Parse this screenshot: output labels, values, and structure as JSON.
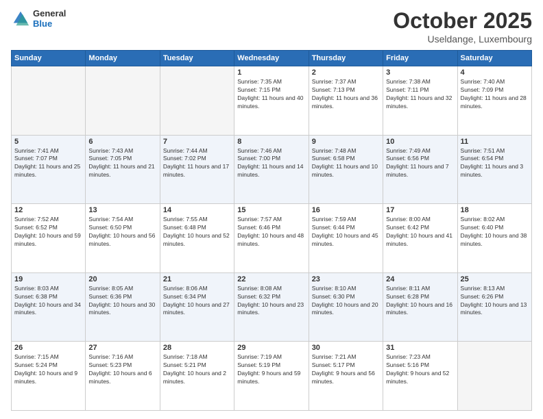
{
  "header": {
    "logo_general": "General",
    "logo_blue": "Blue",
    "title": "October 2025",
    "location": "Useldange, Luxembourg"
  },
  "weekdays": [
    "Sunday",
    "Monday",
    "Tuesday",
    "Wednesday",
    "Thursday",
    "Friday",
    "Saturday"
  ],
  "weeks": [
    [
      {
        "day": "",
        "empty": true
      },
      {
        "day": "",
        "empty": true
      },
      {
        "day": "",
        "empty": true
      },
      {
        "day": "1",
        "sunrise": "7:35 AM",
        "sunset": "7:15 PM",
        "daylight": "11 hours and 40 minutes."
      },
      {
        "day": "2",
        "sunrise": "7:37 AM",
        "sunset": "7:13 PM",
        "daylight": "11 hours and 36 minutes."
      },
      {
        "day": "3",
        "sunrise": "7:38 AM",
        "sunset": "7:11 PM",
        "daylight": "11 hours and 32 minutes."
      },
      {
        "day": "4",
        "sunrise": "7:40 AM",
        "sunset": "7:09 PM",
        "daylight": "11 hours and 28 minutes."
      }
    ],
    [
      {
        "day": "5",
        "sunrise": "7:41 AM",
        "sunset": "7:07 PM",
        "daylight": "11 hours and 25 minutes."
      },
      {
        "day": "6",
        "sunrise": "7:43 AM",
        "sunset": "7:05 PM",
        "daylight": "11 hours and 21 minutes."
      },
      {
        "day": "7",
        "sunrise": "7:44 AM",
        "sunset": "7:02 PM",
        "daylight": "11 hours and 17 minutes."
      },
      {
        "day": "8",
        "sunrise": "7:46 AM",
        "sunset": "7:00 PM",
        "daylight": "11 hours and 14 minutes."
      },
      {
        "day": "9",
        "sunrise": "7:48 AM",
        "sunset": "6:58 PM",
        "daylight": "11 hours and 10 minutes."
      },
      {
        "day": "10",
        "sunrise": "7:49 AM",
        "sunset": "6:56 PM",
        "daylight": "11 hours and 7 minutes."
      },
      {
        "day": "11",
        "sunrise": "7:51 AM",
        "sunset": "6:54 PM",
        "daylight": "11 hours and 3 minutes."
      }
    ],
    [
      {
        "day": "12",
        "sunrise": "7:52 AM",
        "sunset": "6:52 PM",
        "daylight": "10 hours and 59 minutes."
      },
      {
        "day": "13",
        "sunrise": "7:54 AM",
        "sunset": "6:50 PM",
        "daylight": "10 hours and 56 minutes."
      },
      {
        "day": "14",
        "sunrise": "7:55 AM",
        "sunset": "6:48 PM",
        "daylight": "10 hours and 52 minutes."
      },
      {
        "day": "15",
        "sunrise": "7:57 AM",
        "sunset": "6:46 PM",
        "daylight": "10 hours and 48 minutes."
      },
      {
        "day": "16",
        "sunrise": "7:59 AM",
        "sunset": "6:44 PM",
        "daylight": "10 hours and 45 minutes."
      },
      {
        "day": "17",
        "sunrise": "8:00 AM",
        "sunset": "6:42 PM",
        "daylight": "10 hours and 41 minutes."
      },
      {
        "day": "18",
        "sunrise": "8:02 AM",
        "sunset": "6:40 PM",
        "daylight": "10 hours and 38 minutes."
      }
    ],
    [
      {
        "day": "19",
        "sunrise": "8:03 AM",
        "sunset": "6:38 PM",
        "daylight": "10 hours and 34 minutes."
      },
      {
        "day": "20",
        "sunrise": "8:05 AM",
        "sunset": "6:36 PM",
        "daylight": "10 hours and 30 minutes."
      },
      {
        "day": "21",
        "sunrise": "8:06 AM",
        "sunset": "6:34 PM",
        "daylight": "10 hours and 27 minutes."
      },
      {
        "day": "22",
        "sunrise": "8:08 AM",
        "sunset": "6:32 PM",
        "daylight": "10 hours and 23 minutes."
      },
      {
        "day": "23",
        "sunrise": "8:10 AM",
        "sunset": "6:30 PM",
        "daylight": "10 hours and 20 minutes."
      },
      {
        "day": "24",
        "sunrise": "8:11 AM",
        "sunset": "6:28 PM",
        "daylight": "10 hours and 16 minutes."
      },
      {
        "day": "25",
        "sunrise": "8:13 AM",
        "sunset": "6:26 PM",
        "daylight": "10 hours and 13 minutes."
      }
    ],
    [
      {
        "day": "26",
        "sunrise": "7:15 AM",
        "sunset": "5:24 PM",
        "daylight": "10 hours and 9 minutes."
      },
      {
        "day": "27",
        "sunrise": "7:16 AM",
        "sunset": "5:23 PM",
        "daylight": "10 hours and 6 minutes."
      },
      {
        "day": "28",
        "sunrise": "7:18 AM",
        "sunset": "5:21 PM",
        "daylight": "10 hours and 2 minutes."
      },
      {
        "day": "29",
        "sunrise": "7:19 AM",
        "sunset": "5:19 PM",
        "daylight": "9 hours and 59 minutes."
      },
      {
        "day": "30",
        "sunrise": "7:21 AM",
        "sunset": "5:17 PM",
        "daylight": "9 hours and 56 minutes."
      },
      {
        "day": "31",
        "sunrise": "7:23 AM",
        "sunset": "5:16 PM",
        "daylight": "9 hours and 52 minutes."
      },
      {
        "day": "",
        "empty": true
      }
    ]
  ],
  "labels": {
    "sunrise": "Sunrise:",
    "sunset": "Sunset:",
    "daylight": "Daylight:"
  }
}
